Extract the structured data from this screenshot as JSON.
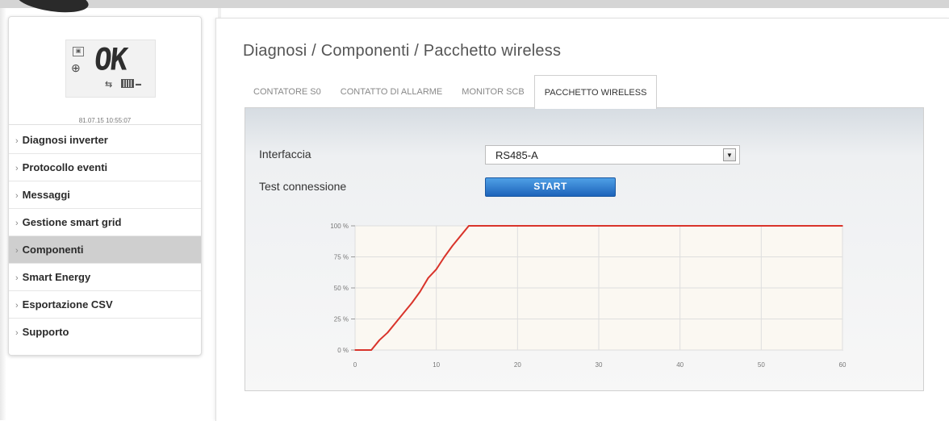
{
  "sidebar": {
    "display": {
      "lcd_text": "OK",
      "timestamp": "81.07.15 10:55:07"
    },
    "items": [
      {
        "label": "Diagnosi inverter",
        "active": false
      },
      {
        "label": "Protocollo eventi",
        "active": false
      },
      {
        "label": "Messaggi",
        "active": false
      },
      {
        "label": "Gestione smart grid",
        "active": false
      },
      {
        "label": "Componenti",
        "active": true
      },
      {
        "label": "Smart Energy",
        "active": false
      },
      {
        "label": "Esportazione CSV",
        "active": false
      },
      {
        "label": "Supporto",
        "active": false
      }
    ]
  },
  "main": {
    "breadcrumb": "Diagnosi / Componenti / Pacchetto wireless",
    "tabs": [
      {
        "label": "CONTATORE S0",
        "active": false
      },
      {
        "label": "CONTATTO DI ALLARME",
        "active": false
      },
      {
        "label": "MONITOR SCB",
        "active": false
      },
      {
        "label": "PACCHETTO WIRELESS",
        "active": true
      }
    ],
    "interfaccia_label": "Interfaccia",
    "interfaccia_value": "RS485-A",
    "test_label": "Test connessione",
    "start_label": "START"
  },
  "colors": {
    "line": "#d9342b",
    "plot_bg": "#fbf8f2",
    "button_top": "#4fa0e6",
    "button_bottom": "#1d63ba",
    "active_nav": "#cfcfcf"
  },
  "chart_data": {
    "type": "line",
    "x": [
      0,
      2,
      3,
      4,
      5,
      6,
      7,
      8,
      9,
      10,
      11,
      12,
      13,
      14,
      60
    ],
    "y": [
      0,
      0,
      8,
      14,
      22,
      30,
      38,
      47,
      58,
      65,
      75,
      84,
      92,
      100,
      100
    ],
    "xlim": [
      0,
      60
    ],
    "ylim": [
      0,
      100
    ],
    "xticks": [
      "0",
      "10",
      "20",
      "30",
      "40",
      "50",
      "60"
    ],
    "yticks": [
      "0 %",
      "25 %",
      "50 %",
      "75 %",
      "100 %"
    ],
    "grid": true
  }
}
